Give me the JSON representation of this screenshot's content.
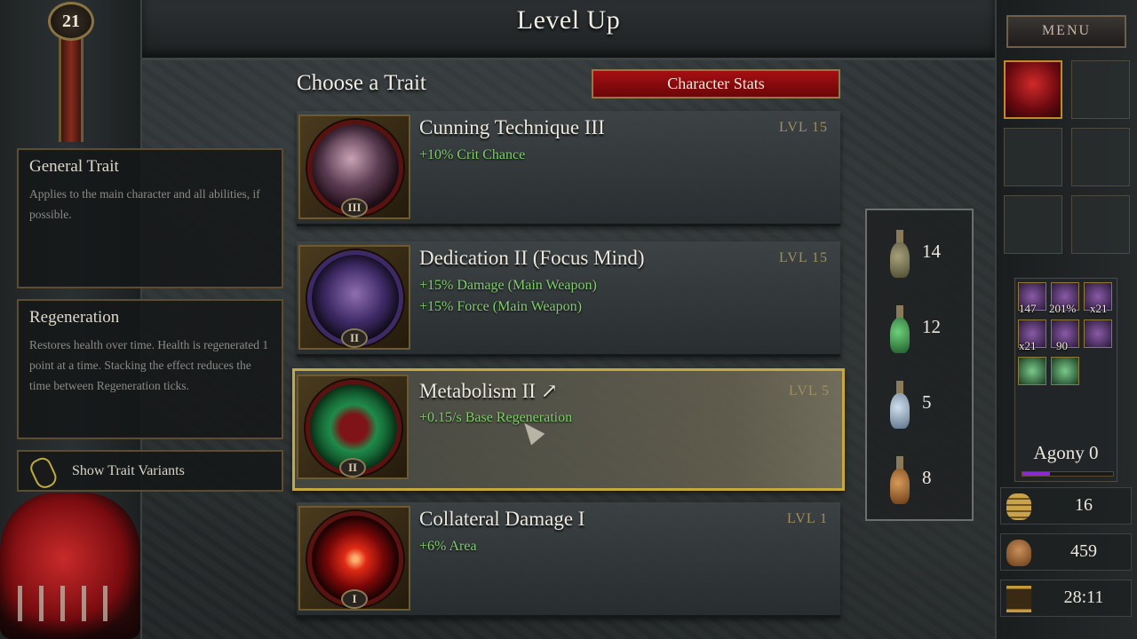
{
  "header": {
    "title": "Level Up",
    "character_level": "21"
  },
  "main": {
    "choose_label": "Choose a Trait",
    "stats_button": "Character Stats",
    "traits": [
      {
        "name": "Cunning Technique III",
        "level": "LVL 15",
        "rank": "III",
        "effects": [
          "+10% Crit Chance"
        ],
        "selected": false
      },
      {
        "name": "Dedication II (Focus Mind)",
        "level": "LVL 15",
        "rank": "II",
        "effects": [
          "+15% Damage (Main Weapon)",
          "+15% Force (Main Weapon)"
        ],
        "selected": false
      },
      {
        "name": "Metabolism II ↗",
        "level": "LVL 5",
        "rank": "II",
        "effects": [
          "+0.15/s Base Regeneration"
        ],
        "selected": true
      },
      {
        "name": "Collateral Damage I",
        "level": "LVL 1",
        "rank": "I",
        "effects": [
          "+6% Area"
        ],
        "selected": false
      }
    ]
  },
  "left_panel": {
    "general": {
      "title": "General Trait",
      "text": "Applies to the main character and all abilities, if possible."
    },
    "detail": {
      "title": "Regeneration",
      "text": "Restores health over time. Health is regenerated 1 point at a time. Stacking the effect reduces the time between Regeneration ticks."
    },
    "variants_button": "Show Trait Variants"
  },
  "potions": [
    {
      "icon": "flask-icon",
      "count": "14"
    },
    {
      "icon": "green-potion-icon",
      "count": "12"
    },
    {
      "icon": "blue-potion-icon",
      "count": "5"
    },
    {
      "icon": "orange-potion-icon",
      "count": "8"
    }
  ],
  "right_panel": {
    "menu_label": "MENU",
    "inventory_counts": [
      "147",
      "201%",
      "x21",
      "x21",
      "90"
    ],
    "agony_label": "Agony 0",
    "agony_fill": 0.3,
    "gold": "16",
    "kills": "459",
    "time": "28:11"
  }
}
